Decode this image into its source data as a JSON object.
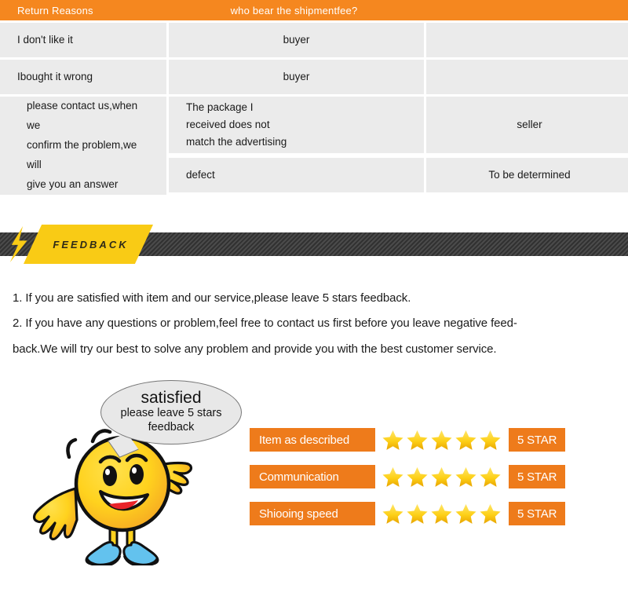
{
  "table": {
    "header": {
      "reason_col": "Return Reasons",
      "fee_col": "who bear the shipmentfee?",
      "note_col": ""
    },
    "rows": [
      {
        "reason": "I don't like it",
        "fee": "buyer"
      },
      {
        "reason": "Ibought it wrong",
        "fee": "buyer"
      },
      {
        "reason_lines": [
          "The package I",
          "received does not",
          "match the advertising"
        ],
        "fee": "seller"
      },
      {
        "reason": "defect",
        "fee": "To be determined"
      }
    ],
    "note_lines": [
      "please contact us,when we",
      "confirm the problem,we will",
      "give you an answer"
    ],
    "header_bg": "#f5871f",
    "cell_bg": "#ebebeb"
  },
  "banner": {
    "tag_label": "FEEDBACK",
    "tag_color": "#f9cb15",
    "bar_color": "#3a3a3a"
  },
  "copy": {
    "line1": "1. If you are satisfied with item and our service,please leave 5 stars feedback.",
    "line2": "2. If you have any questions or problem,feel free to contact us first before you leave negative feed-",
    "line3": "back.We will try our best to solve any problem and provide you with the best customer service."
  },
  "mascot": {
    "bubble": {
      "line1": "satisfied",
      "line2": "please leave 5 stars",
      "line3": "feedback"
    },
    "face_color": "#ffd21e",
    "shoe_color": "#63c2ee",
    "sole_color": "#3faa35"
  },
  "ratings": {
    "star_count": 5,
    "star_color": "#f6c game",
    "accent": "#ee7b1b",
    "rows": [
      {
        "label": "Item as described",
        "stars": 5,
        "badge": "5 STAR"
      },
      {
        "label": "Communication",
        "stars": 5,
        "badge": "5 STAR"
      },
      {
        "label": "Shiooing speed",
        "stars": 5,
        "badge": "5 STAR"
      }
    ]
  }
}
